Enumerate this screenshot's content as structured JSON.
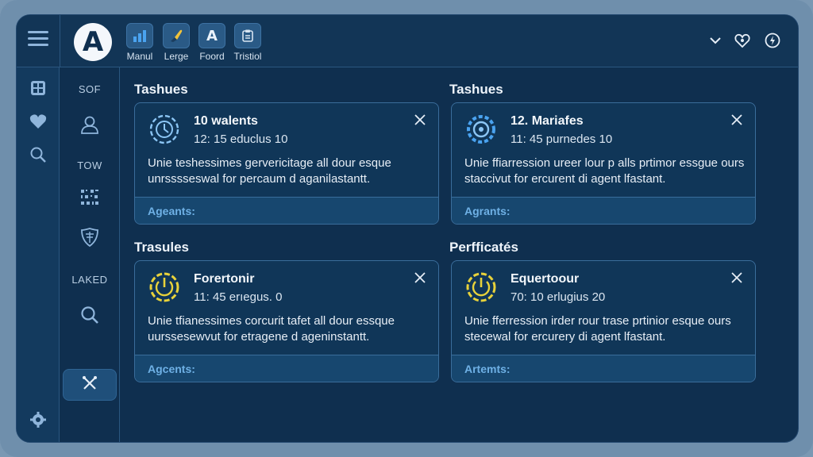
{
  "toolbar": {
    "logo_letter": "A",
    "tools": [
      {
        "label": "Manul",
        "icon": "bar-chart-icon"
      },
      {
        "label": "Lerge",
        "icon": "brush-icon"
      },
      {
        "label": "Foord",
        "icon": "letter-a-icon",
        "glyph": "A"
      },
      {
        "label": "Tristiol",
        "icon": "clipboard-icon"
      }
    ],
    "right_icons": [
      "chevron-down-icon",
      "heart-badge-icon",
      "power-icon"
    ]
  },
  "rail": {
    "icons": [
      "grid-icon",
      "heart-icon",
      "search-icon",
      "settings-icon"
    ]
  },
  "sidebar": {
    "labels": {
      "sof": "SOF",
      "tow": "TOW",
      "laked": "LAKED"
    },
    "icons": [
      "user-icon",
      "qr-icon",
      "shield-icon",
      "search-icon",
      "tools-icon"
    ]
  },
  "sections": [
    {
      "title": "Tashues"
    },
    {
      "title": "Tashues"
    },
    {
      "title": "Trasules"
    },
    {
      "title": "Perfficatés"
    }
  ],
  "cards": [
    {
      "title": "10 walents",
      "subtitle": "12: 15 educlus 10",
      "body": "Unie teshessimes gervericitage all dour esque unrsssseswal for percaum d aganilastantt.",
      "footer": "Ageants:",
      "icon": "gauge-blue-icon",
      "accent": "#6aa9e0"
    },
    {
      "title": "12. Mariafes",
      "subtitle": "11: 45 purnedes 10",
      "body": "Unie ffiarression ureer lour p alls prtimor essgue ours staccivut for ercurent di agent lfastant.",
      "footer": "Agrants:",
      "icon": "gear-blue-icon",
      "accent": "#6aa9e0"
    },
    {
      "title": "Forertonir",
      "subtitle": "11: 45 erıegus. 0",
      "body": "Unie tfianessimes corcurit tafet all dour essque uurssesewvut for etragene d ageninstantt.",
      "footer": "Agcents:",
      "icon": "power-yellow-icon",
      "accent": "#e8d23a"
    },
    {
      "title": "Equertoour",
      "subtitle": "70: 10 erlugius 20",
      "body": "Unie fferression irder rour trase prtinior esque ours stecewal for ercurery di agent lfastant.",
      "footer": "Artemts:",
      "icon": "power-yellow-icon",
      "accent": "#e8d23a"
    }
  ]
}
